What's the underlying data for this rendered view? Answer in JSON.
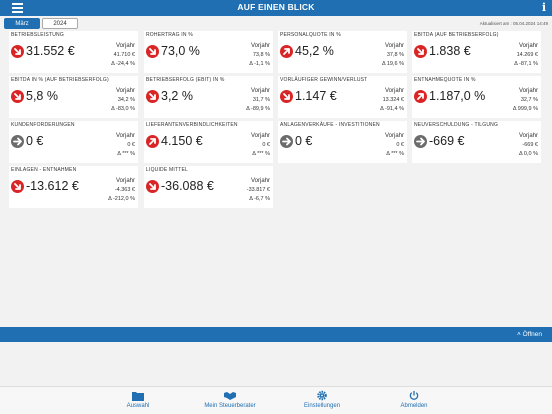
{
  "header": {
    "title": "AUF EINEN BLICK",
    "menu_icon": "hamburger-menu-icon",
    "info_icon": "info-icon"
  },
  "tabs": [
    {
      "label": "März",
      "active": true
    },
    {
      "label": "2024",
      "active": false
    }
  ],
  "updated": "Aktualisiert am : 05.04.2024 14:49",
  "cards": [
    {
      "label": "Betriebsleistung",
      "value": "31.552 €",
      "py_label": "Vorjahr",
      "py_value": "41.710 €",
      "delta": "Δ -24,4 %",
      "trend": "down"
    },
    {
      "label": "Rohertrag in %",
      "value": "73,0 %",
      "py_label": "Vorjahr",
      "py_value": "73,8 %",
      "delta": "Δ -1,1 %",
      "trend": "down"
    },
    {
      "label": "Personalquote in %",
      "value": "45,2 %",
      "py_label": "Vorjahr",
      "py_value": "37,8 %",
      "delta": "Δ 19,6 %",
      "trend": "up"
    },
    {
      "label": "EBITDA (auf Betriebserfolg)",
      "value": "1.838 €",
      "py_label": "Vorjahr",
      "py_value": "14.269 €",
      "delta": "Δ -87,1 %",
      "trend": "down"
    },
    {
      "label": "EBITDA in % (auf Betriebserfolg)",
      "value": "5,8 %",
      "py_label": "Vorjahr",
      "py_value": "34,2 %",
      "delta": "Δ -83,0 %",
      "trend": "down"
    },
    {
      "label": "Betriebserfolg (EBIT) in %",
      "value": "3,2 %",
      "py_label": "Vorjahr",
      "py_value": "31,7 %",
      "delta": "Δ -89,9 %",
      "trend": "down"
    },
    {
      "label": "Vorläufiger Gewinn/Verlust",
      "value": "1.147 €",
      "py_label": "Vorjahr",
      "py_value": "13.324 €",
      "delta": "Δ -91,4 %",
      "trend": "down"
    },
    {
      "label": "Entnahmequote in %",
      "value": "1.187,0 %",
      "py_label": "Vorjahr",
      "py_value": "32,7 %",
      "delta": "Δ 999,9 %",
      "trend": "up"
    },
    {
      "label": "Kundenforderungen",
      "value": "0 €",
      "py_label": "Vorjahr",
      "py_value": "0 €",
      "delta": "Δ *** %",
      "trend": "neutral"
    },
    {
      "label": "Lieferantenverbindlichkeiten",
      "value": "4.150 €",
      "py_label": "Vorjahr",
      "py_value": "0 €",
      "delta": "Δ *** %",
      "trend": "up"
    },
    {
      "label": "Anlagenverkäufe - Investitionen",
      "value": "0 €",
      "py_label": "Vorjahr",
      "py_value": "0 €",
      "delta": "Δ *** %",
      "trend": "neutral"
    },
    {
      "label": "Neuverschuldung - Tilgung",
      "value": "-669 €",
      "py_label": "Vorjahr",
      "py_value": "-669 €",
      "delta": "Δ 0,0 %",
      "trend": "neutral"
    },
    {
      "label": "Einlagen - Entnahmen",
      "value": "-13.612 €",
      "py_label": "Vorjahr",
      "py_value": "-4.363 €",
      "delta": "Δ -212,0 %",
      "trend": "down"
    },
    {
      "label": "Liquide Mittel",
      "value": "-36.088 €",
      "py_label": "Vorjahr",
      "py_value": "-33.817 €",
      "delta": "Δ -6,7 %",
      "trend": "down"
    }
  ],
  "drawer": {
    "open_label": "˄ Öffnen"
  },
  "tabbar": [
    {
      "label": "Auswahl",
      "icon": "folder-icon"
    },
    {
      "label": "Mein Steuerberater",
      "icon": "handshake-icon"
    },
    {
      "label": "Einstellungen",
      "icon": "gear-icon"
    },
    {
      "label": "Abmelden",
      "icon": "power-icon"
    }
  ],
  "colors": {
    "accent": "#1f6fb2",
    "negative": "#d92525",
    "neutral": "#6b6b6b"
  }
}
